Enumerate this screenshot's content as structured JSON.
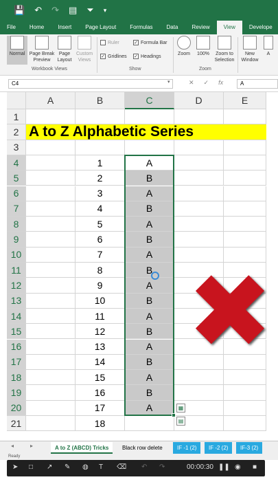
{
  "qat": {
    "save_icon": "save-icon",
    "undo_icon": "undo-icon",
    "redo_icon": "redo-icon",
    "form_icon": "form-icon",
    "filter_icon": "filter-icon",
    "more_icon": "chevron-down-icon"
  },
  "tabs": [
    "File",
    "Home",
    "Insert",
    "Page Layout",
    "Formulas",
    "Data",
    "Review",
    "View",
    "Develope"
  ],
  "ribbon": {
    "normal": "Normal",
    "page_break": [
      "Page Break",
      "Preview"
    ],
    "page": [
      "Page",
      "Layout"
    ],
    "custom": [
      "Custom",
      "Views"
    ],
    "workbook_views": "Workbook Views",
    "ruler": "Ruler",
    "formula_bar": "Formula Bar",
    "gridlines": "Gridlines",
    "headings": "Headings",
    "show": "Show",
    "zoom": "Zoom",
    "zoom100": "100%",
    "zoom_sel": [
      "Zoom to",
      "Selection"
    ],
    "zoom_group": "Zoom",
    "new_window": [
      "New",
      "Window"
    ],
    "arrange": "A"
  },
  "formula_bar": {
    "name_box": "C4",
    "cancel": "✕",
    "enter": "✓",
    "fx": "fx",
    "value": "A"
  },
  "grid": {
    "columns": [
      "A",
      "B",
      "C",
      "D",
      "E"
    ],
    "rows": [
      "1",
      "2",
      "3",
      "4",
      "5",
      "6",
      "7",
      "8",
      "9",
      "10",
      "11",
      "12",
      "13",
      "14",
      "15",
      "16",
      "17",
      "18",
      "19",
      "20",
      "21"
    ],
    "title": "A to Z Alphabetic Series",
    "col_b": [
      "1",
      "2",
      "3",
      "4",
      "5",
      "6",
      "7",
      "8",
      "9",
      "10",
      "11",
      "12",
      "13",
      "14",
      "15",
      "16",
      "17",
      "18"
    ],
    "col_c": [
      "A",
      "B",
      "A",
      "B",
      "A",
      "B",
      "A",
      "B",
      "A",
      "B",
      "A",
      "B",
      "A",
      "B",
      "A",
      "B",
      "A"
    ]
  },
  "overlay": {
    "mark": "✖",
    "color": "#c8141e"
  },
  "sheets": {
    "prev": "◂",
    "next": "▸",
    "tabs": [
      "A to Z (ABCD) Tricks",
      "Black row delete",
      "IF -1 (2)",
      "IF -2 (2)",
      "IF-3 (2)"
    ]
  },
  "status": {
    "text": "Ready"
  },
  "recorder": {
    "time": "00:00:30"
  }
}
